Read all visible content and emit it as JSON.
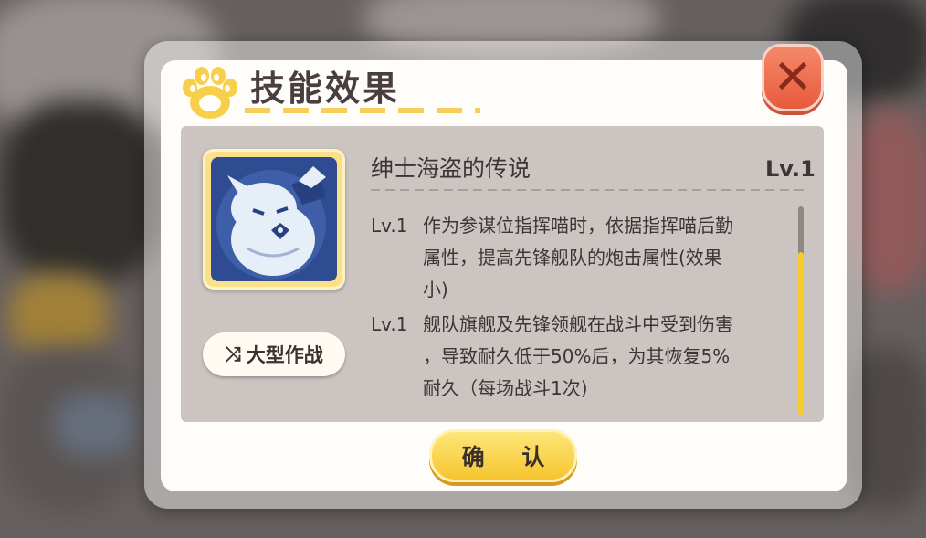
{
  "dialog": {
    "title": "技能效果",
    "close_symbol": "✕",
    "confirm_label": "确 认"
  },
  "skill": {
    "name": "绅士海盗的传说",
    "level": "Lv.1",
    "tag_icon": "⤨",
    "tag_label": "大型作战",
    "cut_line": "···································",
    "effects": [
      {
        "level": "Lv.1",
        "lines": [
          "作为参谋位指挥喵时，依据指挥喵后勤",
          "属性，提高先锋舰队的炮击属性(效果",
          "小)"
        ]
      },
      {
        "level": "Lv.1",
        "lines": [
          "舰队旗舰及先锋领舰在战斗中受到伤害",
          "，导致耐久低于50%后，为其恢复5%",
          "耐久（每场战斗1次)"
        ]
      }
    ]
  },
  "icons": {
    "paw": "paw-icon",
    "close": "close-icon",
    "skill": "pirate-cat-skill-icon",
    "tag": "shuffle-icon"
  },
  "colors": {
    "accent_yellow": "#f6c52e",
    "close_red": "#e85a3c",
    "panel_gray": "#cbc4c0",
    "skill_blue": "#2f4c93"
  }
}
